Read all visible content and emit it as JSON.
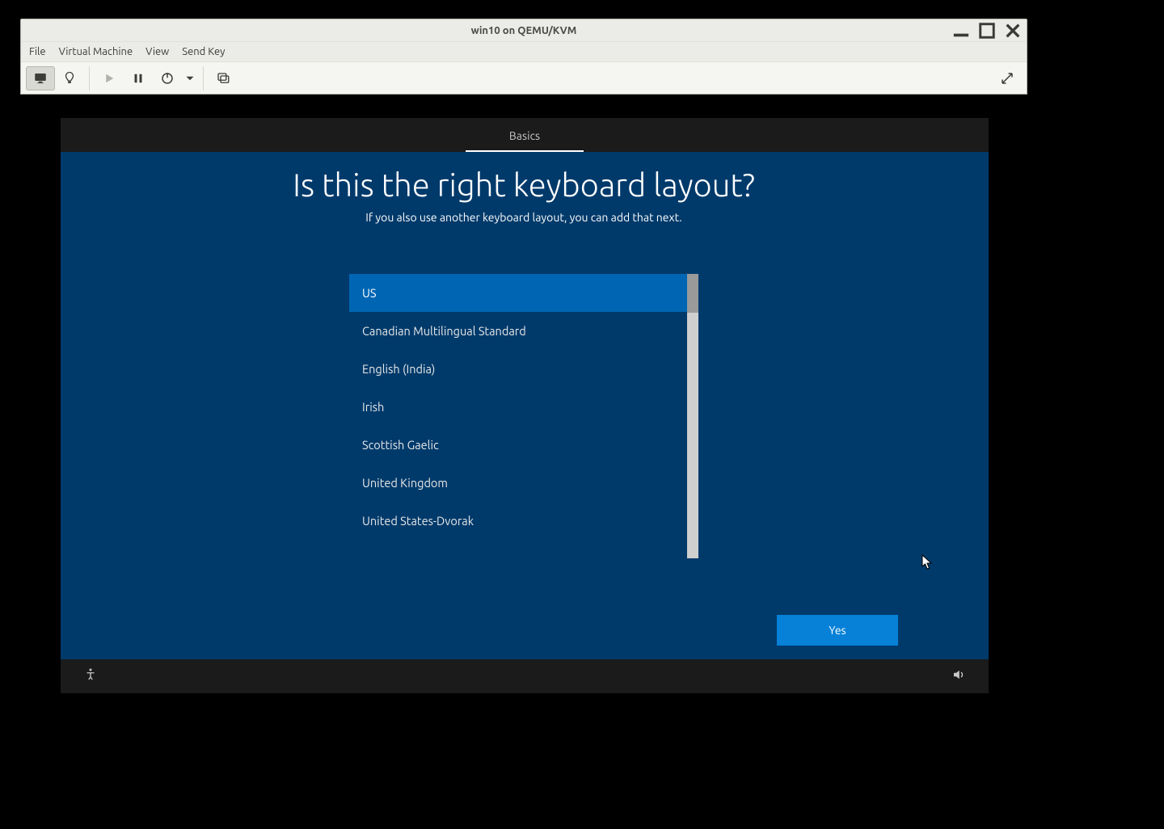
{
  "window": {
    "title": "win10 on QEMU/KVM"
  },
  "menubar": {
    "file": "File",
    "vm": "Virtual Machine",
    "view": "View",
    "sendkey": "Send Key"
  },
  "oobe": {
    "tab": "Basics",
    "heading": "Is this the right keyboard layout?",
    "subheading": "If you also use another keyboard layout, you can add that next.",
    "yes": "Yes",
    "layouts": [
      "US",
      "Canadian Multilingual Standard",
      "English (India)",
      "Irish",
      "Scottish Gaelic",
      "United Kingdom",
      "United States-Dvorak"
    ],
    "selected_index": 0
  }
}
